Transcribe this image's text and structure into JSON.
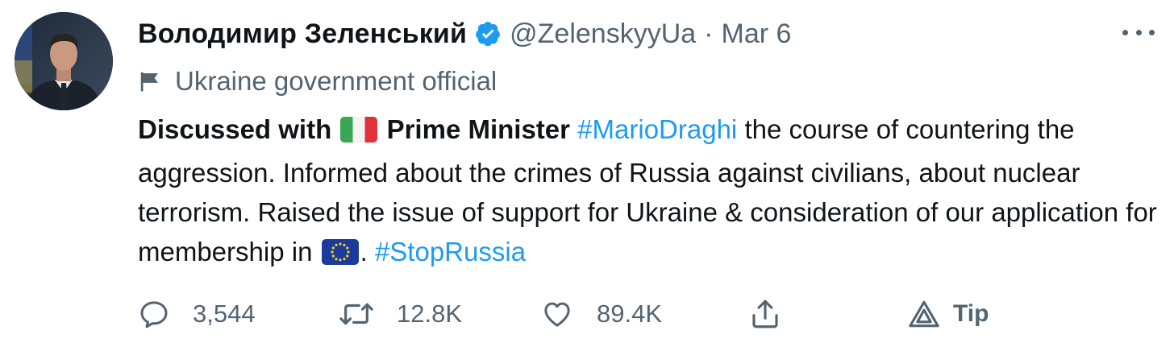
{
  "author": {
    "display_name": "Володимир Зеленський",
    "handle": "@ZelenskyyUa",
    "separator": "·",
    "date": "Mar 6",
    "affiliation_label": "Ukraine government official"
  },
  "tweet": {
    "segments": [
      {
        "text": "Discussed with",
        "style": "bold"
      },
      {
        "text": "Prime Minister",
        "style": "bold"
      },
      {
        "text": "#MarioDraghi",
        "style": "hashtag"
      },
      {
        "text": "the course of countering the aggression. Informed about the crimes of Russia against civilians, about nuclear terrorism. Raised the issue of support for Ukraine & consideration of our application for membership in",
        "style": "plain"
      },
      {
        "text": ".",
        "style": "plain"
      },
      {
        "text": "#StopRussia",
        "style": "hashtag"
      }
    ],
    "emoji": [
      "italy-flag",
      "eu-flag"
    ]
  },
  "actions": {
    "reply": {
      "icon": "reply-icon",
      "count": "3,544"
    },
    "retweet": {
      "icon": "retweet-icon",
      "count": "12.8K"
    },
    "like": {
      "icon": "heart-icon",
      "count": "89.4K"
    },
    "share": {
      "icon": "share-icon"
    },
    "tip": {
      "icon": "tip-icon",
      "label": "Tip"
    }
  },
  "colors": {
    "text": "#0f1419",
    "secondary": "#536471",
    "link": "#1d9bf0",
    "verified": "#1d9bf0"
  }
}
